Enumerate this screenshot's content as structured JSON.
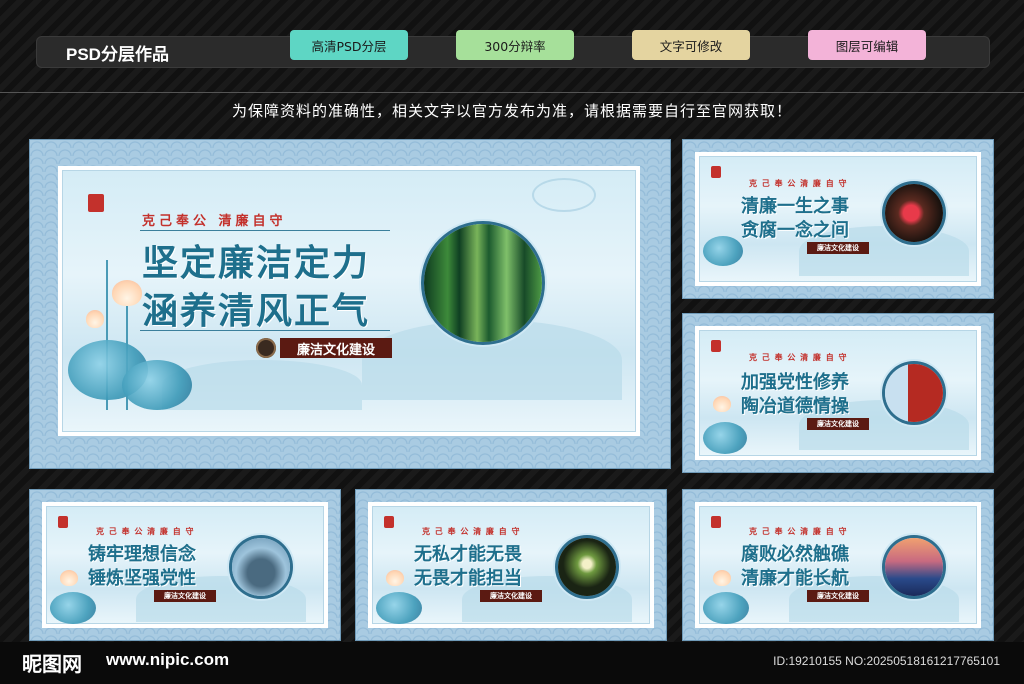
{
  "header": {
    "title": "PSD分层作品",
    "tags": [
      "高清PSD分层",
      "300分辩率",
      "文字可修改",
      "图层可编辑"
    ],
    "notice": "为保障资料的准确性，相关文字以官方发布为准，请根据需要自行至官网获取！"
  },
  "colors": {
    "frame": "#a6c8e0",
    "slogan_red": "#c3312c",
    "title_blue": "#1e6f8c",
    "badge_brown": "#5b1a12"
  },
  "main_board": {
    "slogan": "克己奉公  清廉自守",
    "line1": "坚定廉洁定力",
    "line2": "涵养清风正气",
    "badge": "廉洁文化建设",
    "image": "bamboo-forest"
  },
  "boards": [
    {
      "slogan": "克 己 奉 公  清 廉 自 守",
      "line1": "清廉一生之事",
      "line2": "贪腐一念之间",
      "badge": "廉洁文化建设",
      "image": "plum-blossom"
    },
    {
      "slogan": "克 己 奉 公  清 廉 自 守",
      "line1": "加强党性修养",
      "line2": "陶冶道德情操",
      "badge": "廉洁文化建设",
      "image": "monument-flag"
    },
    {
      "slogan": "克 己 奉 公  清 廉 自 守",
      "line1": "铸牢理想信念",
      "line2": "锤炼坚强党性",
      "badge": "廉洁文化建设",
      "image": "bronze-ding"
    },
    {
      "slogan": "克 己 奉 公  清 廉 自 守",
      "line1": "无私才能无畏",
      "line2": "无畏才能担当",
      "badge": "廉洁文化建设",
      "image": "orchid"
    },
    {
      "slogan": "克 己 奉 公  清 廉 自 守",
      "line1": "腐败必然触礁",
      "line2": "清廉才能长航",
      "badge": "廉洁文化建设",
      "image": "sailing-ship"
    }
  ],
  "footer": {
    "logo": "昵图网",
    "site": "www.nipic.com",
    "id": "ID:19210155 NO:20250518161217765101"
  }
}
